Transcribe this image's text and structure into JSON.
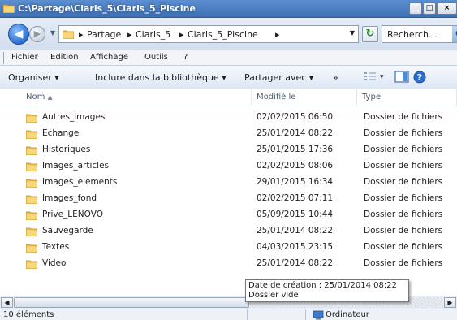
{
  "window": {
    "title": "C:\\Partage\\Claris_5\\Claris_5_Piscine",
    "minimize": "_",
    "maximize": "□",
    "close": "×"
  },
  "address": {
    "crumbs": [
      "Partage",
      "Claris_5",
      "Claris_5_Piscine"
    ],
    "separator": "▸",
    "search_text": "Recherch..."
  },
  "menu": [
    "Fichier",
    "Edition",
    "Affichage",
    "Outils",
    "?"
  ],
  "toolbar": {
    "organize": "Organiser",
    "include": "Inclure dans la bibliothèque",
    "share": "Partager avec",
    "more": "»",
    "dropdown": "▾"
  },
  "columns": {
    "name": "Nom",
    "modified": "Modifié le",
    "type": "Type"
  },
  "files": [
    {
      "name": "Autres_images",
      "modified": "02/02/2015 06:50",
      "type": "Dossier de fichiers"
    },
    {
      "name": "Echange",
      "modified": "25/01/2014 08:22",
      "type": "Dossier de fichiers"
    },
    {
      "name": "Historiques",
      "modified": "25/01/2015 17:36",
      "type": "Dossier de fichiers"
    },
    {
      "name": "Images_articles",
      "modified": "02/02/2015 08:06",
      "type": "Dossier de fichiers"
    },
    {
      "name": "Images_elements",
      "modified": "29/01/2015 16:34",
      "type": "Dossier de fichiers"
    },
    {
      "name": "Images_fond",
      "modified": "02/02/2015 07:11",
      "type": "Dossier de fichiers"
    },
    {
      "name": "Prive_LENOVO",
      "modified": "05/09/2015 10:44",
      "type": "Dossier de fichiers"
    },
    {
      "name": "Sauvegarde",
      "modified": "25/01/2014 08:22",
      "type": "Dossier de fichiers"
    },
    {
      "name": "Textes",
      "modified": "04/03/2015 23:15",
      "type": "Dossier de fichiers"
    },
    {
      "name": "Video",
      "modified": "25/01/2014 08:22",
      "type": "Dossier de fichiers"
    }
  ],
  "tooltip": {
    "line1": "Date de création : 25/01/2014 08:22",
    "line2": "Dossier vide"
  },
  "status": {
    "count": "10 éléments",
    "location": "Ordinateur"
  },
  "colors": {
    "folder": "#f2c24e",
    "title_bar": "#4a7cc0"
  }
}
